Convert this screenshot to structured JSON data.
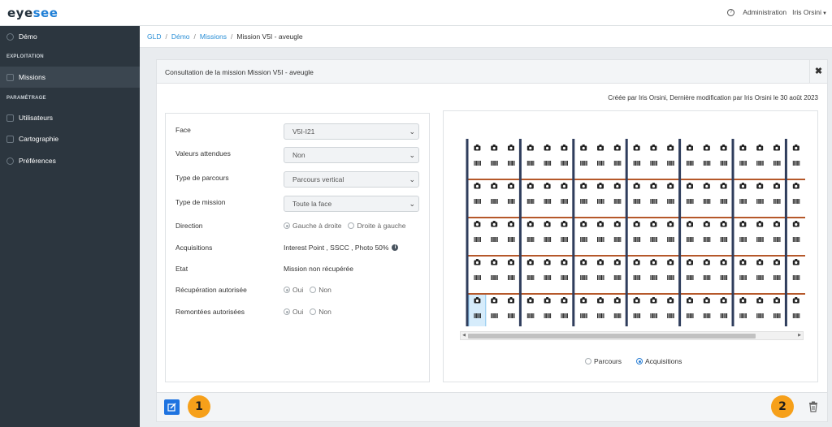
{
  "app": {
    "logo_a": "eye",
    "logo_b": "see"
  },
  "topbar": {
    "help_icon": "question-circle-icon",
    "admin_label": "Administration",
    "user_label": "Iris Orsini"
  },
  "sidebar": {
    "top_item": "Démo",
    "section1": "EXPLOITATION",
    "missions": "Missions",
    "section2": "PARAMÉTRAGE",
    "users": "Utilisateurs",
    "carto": "Cartographie",
    "prefs": "Préférences"
  },
  "breadcrumb": {
    "b1": "GLD",
    "b2": "Démo",
    "b3": "Missions",
    "current": "Mission V5I - aveugle",
    "sep": "/"
  },
  "card": {
    "title": "Consultation de la mission Mission V5I - aveugle",
    "close": "✖",
    "created": "Créée par Iris Orsini, Dernière modification par Iris Orsini le 30 août 2023"
  },
  "form": {
    "face_label": "Face",
    "face_value": "V5I-I21",
    "attendues_label": "Valeurs attendues",
    "attendues_value": "Non",
    "parcours_label": "Type de parcours",
    "parcours_value": "Parcours vertical",
    "mission_type_label": "Type de mission",
    "mission_type_value": "Toute la face",
    "direction_label": "Direction",
    "direction_opt1": "Gauche à droite",
    "direction_opt2": "Droite à gauche",
    "acq_label": "Acquisitions",
    "acq_value": "Interest Point , SSCC , Photo 50%",
    "etat_label": "Etat",
    "etat_value": "Mission non récupérée",
    "recup_label": "Récupération autorisée",
    "recup_oui": "Oui",
    "recup_non": "Non",
    "remontees_label": "Remontées autorisées",
    "rem_oui": "Oui",
    "rem_non": "Non",
    "chevron": "⌄"
  },
  "grid_view": {
    "rows": 5,
    "cols": 20,
    "column_groups": [
      3,
      3,
      3,
      3,
      3,
      3,
      2
    ],
    "selected_cell": {
      "row": 5,
      "col": 1
    },
    "colors": {
      "rack": "#2f3d5c",
      "shelf": "#b5582a",
      "selected": "#d6ecfb",
      "icon": "#222222"
    },
    "cell_icons": [
      "camera-icon",
      "barcode-icon"
    ],
    "opt_parcours": "Parcours",
    "opt_acquisitions": "Acquisitions",
    "selected_option": "Acquisitions"
  },
  "footer": {
    "marker1": "1",
    "marker2": "2",
    "edit_icon": "edit-icon",
    "trash_icon": "trash-icon"
  },
  "colors": {
    "accent": "#2a8fd6",
    "sidebar": "#2c363f",
    "marker": "#f6a01a",
    "button": "#1e73e0"
  }
}
